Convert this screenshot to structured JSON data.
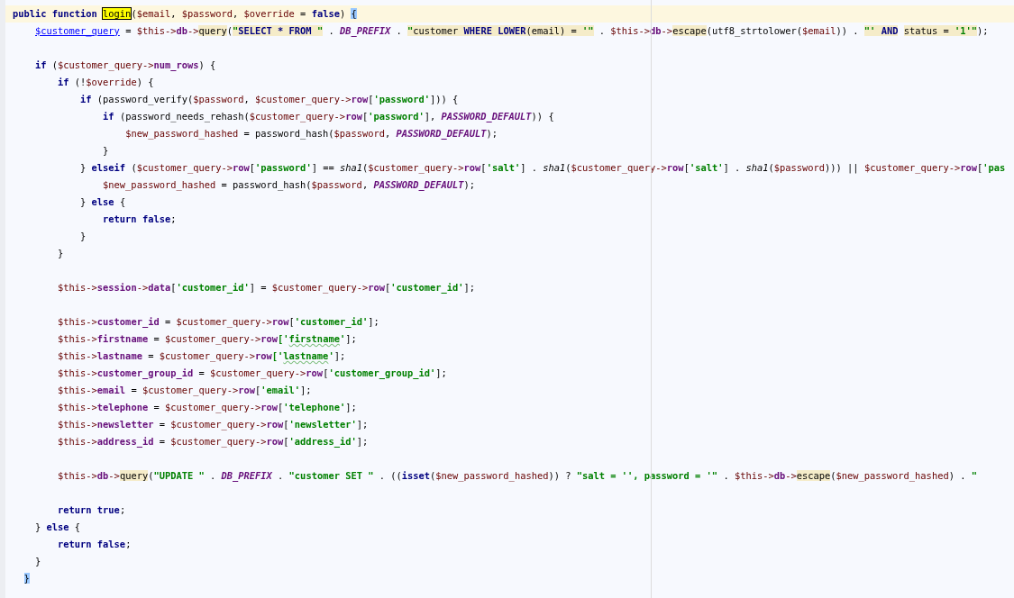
{
  "editor": {
    "lines": [
      {
        "kind": "code",
        "current_line": true,
        "tokens": [
          {
            "text": "public function ",
            "kind": "kw"
          },
          {
            "text": "login",
            "kind": "plain",
            "search_match": true
          },
          {
            "text": "(",
            "kind": "plain"
          },
          {
            "text": "$email",
            "kind": "var"
          },
          {
            "text": ", ",
            "kind": "plain"
          },
          {
            "text": "$password",
            "kind": "var"
          },
          {
            "text": ", ",
            "kind": "plain"
          },
          {
            "text": "$override",
            "kind": "var"
          },
          {
            "text": " = ",
            "kind": "plain"
          },
          {
            "text": "false",
            "kind": "kw"
          },
          {
            "text": ") ",
            "kind": "plain"
          },
          {
            "text": "{",
            "kind": "plain",
            "matched_brace": true
          }
        ]
      },
      {
        "kind": "code",
        "current_line": false,
        "tokens": [
          {
            "text": "    $customer_query",
            "kind": "link"
          },
          {
            "text": " = ",
            "kind": "plain"
          },
          {
            "text": "$this->",
            "kind": "var"
          },
          {
            "text": "db",
            "kind": "field"
          },
          {
            "text": "->",
            "kind": "var"
          },
          {
            "text": "query",
            "kind": "plain",
            "injected": true
          },
          {
            "text": "(",
            "kind": "plain"
          },
          {
            "text": "\"",
            "kind": "str",
            "injected": true
          },
          {
            "text": "SELECT * FROM ",
            "kind": "kw",
            "injected": true
          },
          {
            "text": "\"",
            "kind": "str",
            "injected": true
          },
          {
            "text": " . ",
            "kind": "plain"
          },
          {
            "text": "DB_PREFIX",
            "kind": "const"
          },
          {
            "text": " . ",
            "kind": "plain"
          },
          {
            "text": "\"",
            "kind": "str",
            "injected": true
          },
          {
            "text": "customer ",
            "kind": "plain",
            "injected": true
          },
          {
            "text": "WHERE LOWER",
            "kind": "kw",
            "injected": true
          },
          {
            "text": "(email) = ",
            "kind": "plain",
            "injected": true
          },
          {
            "text": "'\"",
            "kind": "str",
            "injected": true
          },
          {
            "text": " . ",
            "kind": "plain"
          },
          {
            "text": "$this->",
            "kind": "var"
          },
          {
            "text": "db",
            "kind": "field"
          },
          {
            "text": "->",
            "kind": "var"
          },
          {
            "text": "escape",
            "kind": "plain",
            "injected": true
          },
          {
            "text": "(utf8_strtolower(",
            "kind": "plain"
          },
          {
            "text": "$email",
            "kind": "var"
          },
          {
            "text": ")) . ",
            "kind": "plain"
          },
          {
            "text": "\"' ",
            "kind": "str",
            "injected": true
          },
          {
            "text": "AND",
            "kind": "kw",
            "injected": true
          },
          {
            "text": " status = ",
            "kind": "plain",
            "injected": true
          },
          {
            "text": "'1'\"",
            "kind": "str",
            "injected": true
          },
          {
            "text": ");",
            "kind": "plain"
          }
        ]
      },
      {
        "kind": "blank"
      },
      {
        "kind": "code",
        "current_line": false,
        "tokens": [
          {
            "text": "    if",
            "kind": "kw"
          },
          {
            "text": " (",
            "kind": "plain"
          },
          {
            "text": "$customer_query->",
            "kind": "var"
          },
          {
            "text": "num_rows",
            "kind": "field"
          },
          {
            "text": ") {",
            "kind": "plain"
          }
        ]
      },
      {
        "kind": "code",
        "current_line": false,
        "tokens": [
          {
            "text": "        if",
            "kind": "kw"
          },
          {
            "text": " (!",
            "kind": "plain"
          },
          {
            "text": "$override",
            "kind": "var"
          },
          {
            "text": ") {",
            "kind": "plain"
          }
        ]
      },
      {
        "kind": "code",
        "current_line": false,
        "tokens": [
          {
            "text": "            if",
            "kind": "kw"
          },
          {
            "text": " (password_verify(",
            "kind": "plain"
          },
          {
            "text": "$password",
            "kind": "var"
          },
          {
            "text": ", ",
            "kind": "plain"
          },
          {
            "text": "$customer_query->",
            "kind": "var"
          },
          {
            "text": "row",
            "kind": "field"
          },
          {
            "text": "[",
            "kind": "plain"
          },
          {
            "text": "'password'",
            "kind": "str"
          },
          {
            "text": "])) {",
            "kind": "plain"
          }
        ]
      },
      {
        "kind": "code",
        "current_line": false,
        "tokens": [
          {
            "text": "                if",
            "kind": "kw"
          },
          {
            "text": " (password_needs_rehash(",
            "kind": "plain"
          },
          {
            "text": "$customer_query->",
            "kind": "var"
          },
          {
            "text": "row",
            "kind": "field"
          },
          {
            "text": "[",
            "kind": "plain"
          },
          {
            "text": "'password'",
            "kind": "str"
          },
          {
            "text": "], ",
            "kind": "plain"
          },
          {
            "text": "PASSWORD_DEFAULT",
            "kind": "const"
          },
          {
            "text": ")) {",
            "kind": "plain"
          }
        ]
      },
      {
        "kind": "code",
        "current_line": false,
        "tokens": [
          {
            "text": "                    $new_password_hashed",
            "kind": "var"
          },
          {
            "text": " = password_hash(",
            "kind": "plain"
          },
          {
            "text": "$password",
            "kind": "var"
          },
          {
            "text": ", ",
            "kind": "plain"
          },
          {
            "text": "PASSWORD_DEFAULT",
            "kind": "const"
          },
          {
            "text": ");",
            "kind": "plain"
          }
        ]
      },
      {
        "kind": "code",
        "current_line": false,
        "tokens": [
          {
            "text": "                }",
            "kind": "plain"
          }
        ]
      },
      {
        "kind": "code",
        "current_line": false,
        "tokens": [
          {
            "text": "            } ",
            "kind": "plain"
          },
          {
            "text": "elseif",
            "kind": "kw"
          },
          {
            "text": " (",
            "kind": "plain"
          },
          {
            "text": "$customer_query->",
            "kind": "var"
          },
          {
            "text": "row",
            "kind": "field"
          },
          {
            "text": "[",
            "kind": "plain"
          },
          {
            "text": "'password'",
            "kind": "str"
          },
          {
            "text": "] == ",
            "kind": "plain"
          },
          {
            "text": "sha1",
            "kind": "italic"
          },
          {
            "text": "(",
            "kind": "plain"
          },
          {
            "text": "$customer_query->",
            "kind": "var"
          },
          {
            "text": "row",
            "kind": "field"
          },
          {
            "text": "[",
            "kind": "plain"
          },
          {
            "text": "'salt'",
            "kind": "str"
          },
          {
            "text": "] . ",
            "kind": "plain"
          },
          {
            "text": "sha1",
            "kind": "italic"
          },
          {
            "text": "(",
            "kind": "plain"
          },
          {
            "text": "$customer_query->",
            "kind": "var"
          },
          {
            "text": "row",
            "kind": "field"
          },
          {
            "text": "[",
            "kind": "plain"
          },
          {
            "text": "'salt'",
            "kind": "str"
          },
          {
            "text": "] . ",
            "kind": "plain"
          },
          {
            "text": "sha1",
            "kind": "italic"
          },
          {
            "text": "(",
            "kind": "plain"
          },
          {
            "text": "$password",
            "kind": "var"
          },
          {
            "text": "))) || ",
            "kind": "plain"
          },
          {
            "text": "$customer_query->",
            "kind": "var"
          },
          {
            "text": "row",
            "kind": "field"
          },
          {
            "text": "[",
            "kind": "plain"
          },
          {
            "text": "'pas",
            "kind": "str"
          }
        ]
      },
      {
        "kind": "code",
        "current_line": false,
        "tokens": [
          {
            "text": "                $new_password_hashed",
            "kind": "var"
          },
          {
            "text": " = password_hash(",
            "kind": "plain"
          },
          {
            "text": "$password",
            "kind": "var"
          },
          {
            "text": ", ",
            "kind": "plain"
          },
          {
            "text": "PASSWORD_DEFAULT",
            "kind": "const"
          },
          {
            "text": ");",
            "kind": "plain"
          }
        ]
      },
      {
        "kind": "code",
        "current_line": false,
        "tokens": [
          {
            "text": "            } ",
            "kind": "plain"
          },
          {
            "text": "else",
            "kind": "kw"
          },
          {
            "text": " {",
            "kind": "plain"
          }
        ]
      },
      {
        "kind": "code",
        "current_line": false,
        "tokens": [
          {
            "text": "                return false",
            "kind": "kw"
          },
          {
            "text": ";",
            "kind": "plain"
          }
        ]
      },
      {
        "kind": "code",
        "current_line": false,
        "tokens": [
          {
            "text": "            }",
            "kind": "plain"
          }
        ]
      },
      {
        "kind": "code",
        "current_line": false,
        "tokens": [
          {
            "text": "        }",
            "kind": "plain"
          }
        ]
      },
      {
        "kind": "blank"
      },
      {
        "kind": "code",
        "current_line": false,
        "tokens": [
          {
            "text": "        $this->",
            "kind": "var"
          },
          {
            "text": "session",
            "kind": "field"
          },
          {
            "text": "->",
            "kind": "var"
          },
          {
            "text": "data",
            "kind": "field"
          },
          {
            "text": "[",
            "kind": "plain"
          },
          {
            "text": "'customer_id'",
            "kind": "str"
          },
          {
            "text": "] = ",
            "kind": "plain"
          },
          {
            "text": "$customer_query->",
            "kind": "var"
          },
          {
            "text": "row",
            "kind": "field"
          },
          {
            "text": "[",
            "kind": "plain"
          },
          {
            "text": "'customer_id'",
            "kind": "str"
          },
          {
            "text": "];",
            "kind": "plain"
          }
        ]
      },
      {
        "kind": "blank"
      },
      {
        "kind": "code",
        "current_line": false,
        "tokens": [
          {
            "text": "        $this->",
            "kind": "var"
          },
          {
            "text": "customer_id",
            "kind": "field"
          },
          {
            "text": " = ",
            "kind": "plain"
          },
          {
            "text": "$customer_query->",
            "kind": "var"
          },
          {
            "text": "row",
            "kind": "field"
          },
          {
            "text": "[",
            "kind": "plain"
          },
          {
            "text": "'customer_id'",
            "kind": "str"
          },
          {
            "text": "];",
            "kind": "plain"
          }
        ]
      },
      {
        "kind": "code",
        "current_line": false,
        "tokens": [
          {
            "text": "        $this->",
            "kind": "var"
          },
          {
            "text": "firstname",
            "kind": "field"
          },
          {
            "text": " = ",
            "kind": "plain"
          },
          {
            "text": "$customer_query->",
            "kind": "var"
          },
          {
            "text": "row",
            "kind": "field"
          },
          {
            "text": "['",
            "kind": "str"
          },
          {
            "text": "firstname",
            "kind": "str",
            "typo": true
          },
          {
            "text": "'",
            "kind": "str"
          },
          {
            "text": "];",
            "kind": "plain"
          }
        ]
      },
      {
        "kind": "code",
        "current_line": false,
        "tokens": [
          {
            "text": "        $this->",
            "kind": "var"
          },
          {
            "text": "lastname",
            "kind": "field"
          },
          {
            "text": " = ",
            "kind": "plain"
          },
          {
            "text": "$customer_query->",
            "kind": "var"
          },
          {
            "text": "row",
            "kind": "field"
          },
          {
            "text": "['",
            "kind": "str"
          },
          {
            "text": "lastname",
            "kind": "str",
            "typo": true
          },
          {
            "text": "'",
            "kind": "str"
          },
          {
            "text": "];",
            "kind": "plain"
          }
        ]
      },
      {
        "kind": "code",
        "current_line": false,
        "tokens": [
          {
            "text": "        $this->",
            "kind": "var"
          },
          {
            "text": "customer_group_id",
            "kind": "field"
          },
          {
            "text": " = ",
            "kind": "plain"
          },
          {
            "text": "$customer_query->",
            "kind": "var"
          },
          {
            "text": "row",
            "kind": "field"
          },
          {
            "text": "[",
            "kind": "plain"
          },
          {
            "text": "'customer_group_id'",
            "kind": "str"
          },
          {
            "text": "];",
            "kind": "plain"
          }
        ]
      },
      {
        "kind": "code",
        "current_line": false,
        "tokens": [
          {
            "text": "        $this->",
            "kind": "var"
          },
          {
            "text": "email",
            "kind": "field"
          },
          {
            "text": " = ",
            "kind": "plain"
          },
          {
            "text": "$customer_query->",
            "kind": "var"
          },
          {
            "text": "row",
            "kind": "field"
          },
          {
            "text": "[",
            "kind": "plain"
          },
          {
            "text": "'email'",
            "kind": "str"
          },
          {
            "text": "];",
            "kind": "plain"
          }
        ]
      },
      {
        "kind": "code",
        "current_line": false,
        "tokens": [
          {
            "text": "        $this->",
            "kind": "var"
          },
          {
            "text": "telephone",
            "kind": "field"
          },
          {
            "text": " = ",
            "kind": "plain"
          },
          {
            "text": "$customer_query->",
            "kind": "var"
          },
          {
            "text": "row",
            "kind": "field"
          },
          {
            "text": "[",
            "kind": "plain"
          },
          {
            "text": "'telephone'",
            "kind": "str"
          },
          {
            "text": "];",
            "kind": "plain"
          }
        ]
      },
      {
        "kind": "code",
        "current_line": false,
        "tokens": [
          {
            "text": "        $this->",
            "kind": "var"
          },
          {
            "text": "newsletter",
            "kind": "field"
          },
          {
            "text": " = ",
            "kind": "plain"
          },
          {
            "text": "$customer_query->",
            "kind": "var"
          },
          {
            "text": "row",
            "kind": "field"
          },
          {
            "text": "[",
            "kind": "plain"
          },
          {
            "text": "'newsletter'",
            "kind": "str"
          },
          {
            "text": "];",
            "kind": "plain"
          }
        ]
      },
      {
        "kind": "code",
        "current_line": false,
        "tokens": [
          {
            "text": "        $this->",
            "kind": "var"
          },
          {
            "text": "address_id",
            "kind": "field"
          },
          {
            "text": " = ",
            "kind": "plain"
          },
          {
            "text": "$customer_query->",
            "kind": "var"
          },
          {
            "text": "row",
            "kind": "field"
          },
          {
            "text": "[",
            "kind": "plain"
          },
          {
            "text": "'address_id'",
            "kind": "str"
          },
          {
            "text": "];",
            "kind": "plain"
          }
        ]
      },
      {
        "kind": "blank"
      },
      {
        "kind": "code",
        "current_line": false,
        "tokens": [
          {
            "text": "        $this->",
            "kind": "var"
          },
          {
            "text": "db",
            "kind": "field"
          },
          {
            "text": "->",
            "kind": "var"
          },
          {
            "text": "query",
            "kind": "plain",
            "injected": true
          },
          {
            "text": "(",
            "kind": "plain"
          },
          {
            "text": "\"UPDATE \"",
            "kind": "str"
          },
          {
            "text": " . ",
            "kind": "plain"
          },
          {
            "text": "DB_PREFIX",
            "kind": "const"
          },
          {
            "text": " . ",
            "kind": "plain"
          },
          {
            "text": "\"customer SET \"",
            "kind": "str"
          },
          {
            "text": " . ((",
            "kind": "plain"
          },
          {
            "text": "isset",
            "kind": "kw"
          },
          {
            "text": "(",
            "kind": "plain"
          },
          {
            "text": "$new_password_hashed",
            "kind": "var"
          },
          {
            "text": ")) ? ",
            "kind": "plain"
          },
          {
            "text": "\"salt = '', password = '\"",
            "kind": "str"
          },
          {
            "text": " . ",
            "kind": "plain"
          },
          {
            "text": "$this->",
            "kind": "var"
          },
          {
            "text": "db",
            "kind": "field"
          },
          {
            "text": "->",
            "kind": "var"
          },
          {
            "text": "escape",
            "kind": "plain",
            "injected": true
          },
          {
            "text": "(",
            "kind": "plain"
          },
          {
            "text": "$new_password_hashed",
            "kind": "var"
          },
          {
            "text": ") . ",
            "kind": "plain"
          },
          {
            "text": "\"",
            "kind": "str"
          }
        ]
      },
      {
        "kind": "blank"
      },
      {
        "kind": "code",
        "current_line": false,
        "tokens": [
          {
            "text": "        return true",
            "kind": "kw"
          },
          {
            "text": ";",
            "kind": "plain"
          }
        ]
      },
      {
        "kind": "code",
        "current_line": false,
        "tokens": [
          {
            "text": "    } ",
            "kind": "plain"
          },
          {
            "text": "else",
            "kind": "kw"
          },
          {
            "text": " {",
            "kind": "plain"
          }
        ]
      },
      {
        "kind": "code",
        "current_line": false,
        "tokens": [
          {
            "text": "        return false",
            "kind": "kw"
          },
          {
            "text": ";",
            "kind": "plain"
          }
        ]
      },
      {
        "kind": "code",
        "current_line": false,
        "tokens": [
          {
            "text": "    }",
            "kind": "plain"
          }
        ]
      },
      {
        "kind": "code",
        "current_line": false,
        "tokens": [
          {
            "text": "  }",
            "kind": "plain",
            "matched_brace": true
          }
        ]
      }
    ]
  }
}
